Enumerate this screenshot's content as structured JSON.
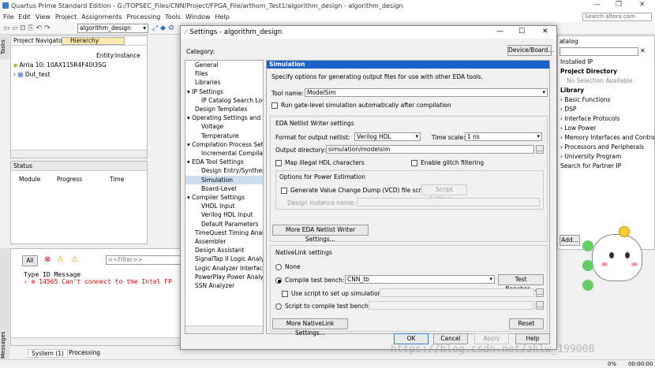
{
  "app": {
    "title": "Quartus Prime Standard Edition - G:/TOPSEC_Files/CNN/Project/FPGA_File/arthom_Test1/algorithm_design - algorithm_design",
    "menu": [
      "File",
      "Edit",
      "View",
      "Project",
      "Assignments",
      "Processing",
      "Tools",
      "Window",
      "Help"
    ],
    "search_placeholder": "Search altera.com",
    "project_combo": "algorithm_design"
  },
  "navigator": {
    "tab1": "Project Navigator",
    "tab2": "Hierarchy",
    "header": "Entity:Instance",
    "device": "Arria 10: 10AX115R4F40I3SG",
    "top": "Dut_test"
  },
  "status": {
    "title": "Status",
    "cols": [
      "Module",
      "Progress",
      "Time"
    ]
  },
  "tasks_label": "Tasks",
  "messages": {
    "side_label": "Messages",
    "all": "All",
    "filter": "<<Filter>>",
    "header": "Type  ID  Message",
    "error_id": "14565",
    "error_text": "Can't connect to the Intel FP",
    "tabs": [
      "System (1)",
      "Processing"
    ]
  },
  "ip_catalog": {
    "title": "atalog",
    "items": [
      "Installed IP",
      "Project Directory",
      "No Selection Available",
      "Library",
      "Basic Functions",
      "DSP",
      "Interface Protocols",
      "Low Power",
      "Memory Interfaces and Controll",
      "Processors and Peripherals",
      "University Program",
      "Search for Partner IP"
    ],
    "add": "Add..."
  },
  "dialog": {
    "title": "Settings - algorithm_design",
    "category_label": "Category:",
    "device_btn": "Device/Board...",
    "categories": [
      "General",
      "Files",
      "Libraries",
      "IP Settings",
      "IP Catalog Search Loca",
      "Design Templates",
      "Operating Settings and C",
      "Voltage",
      "Temperature",
      "Compilation Process Set",
      "Incremental Compilati",
      "EDA Tool Settings",
      "Design Entry/Synthesi",
      "Simulation",
      "Board-Level",
      "Compiler Settings",
      "VHDL Input",
      "Verilog HDL Input",
      "Default Parameters",
      "TimeQuest Timing Analy",
      "Assembler",
      "Design Assistant",
      "SignalTap II Logic Analy",
      "Logic Analyzer Interface",
      "PowerPlay Power Analy",
      "SSN Analyzer"
    ],
    "page_title": "Simulation",
    "desc": "Specify options for generating output files for use with other EDA tools.",
    "tool_name_label": "Tool name:",
    "tool_name": "ModelSim",
    "gate_level": "Run gate-level simulation automatically after compilation",
    "netlist_group": "EDA Netlist Writer settings",
    "format_label": "Format for output netlist:",
    "format": "Verilog HDL",
    "timescale_label": "Time scale:",
    "timescale": "1 ns",
    "outdir_label": "Output directory:",
    "outdir": "simulation/modelsim",
    "map_illegal": "Map illegal HDL characters",
    "glitch": "Enable glitch filtering",
    "power_group": "Options for Power Estimation",
    "vcd": "Generate Value Change Dump (VCD) file script",
    "script_settings": "Script Settings...",
    "instance_label": "Design instance name:",
    "more_netlist": "More EDA Netlist Writer Settings...",
    "nativelink_group": "NativeLink settings",
    "none": "None",
    "compile_tb": "Compile test bench:",
    "tb": "CNN_tb",
    "test_benches": "Test Benches...",
    "use_script": "Use script to set up simulation:",
    "script_compile": "Script to compile test bench:",
    "more_nativelink": "More NativeLink Settings...",
    "reset": "Reset",
    "ok": "OK",
    "cancel": "Cancel",
    "apply": "Apply",
    "help": "Help"
  },
  "statusbar": {
    "progress": "0%",
    "time": "00:00:00"
  },
  "watermark": "https://blog.csdn.net/zhlw_199008"
}
